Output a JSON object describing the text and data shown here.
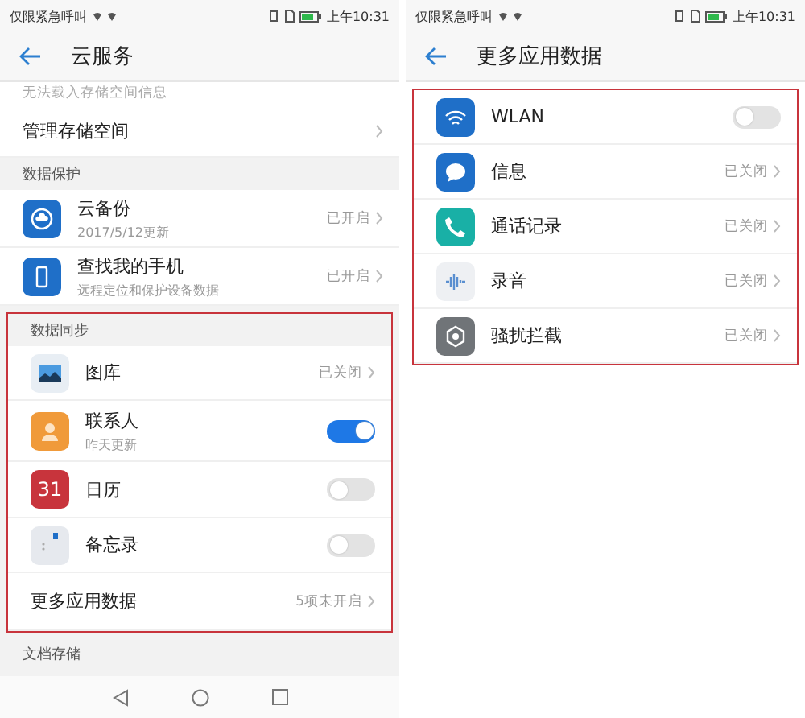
{
  "left_screen": {
    "status_bar": {
      "carrier": "仅限紧急呼叫",
      "time": "上午10:31"
    },
    "title": "云服务",
    "cut_note": "无法载入存储空间信息",
    "manage_row": {
      "label": "管理存储空间"
    },
    "sections": [
      {
        "title": "数据保护",
        "highlighted": false,
        "rows": [
          {
            "kind": "status",
            "label": "云备份",
            "sub": "2017/5/12更新",
            "value": "已开启"
          },
          {
            "kind": "status",
            "label": "查找我的手机",
            "sub": "远程定位和保护设备数据",
            "value": "已开启"
          }
        ]
      },
      {
        "title": "数据同步",
        "highlighted": true,
        "rows": [
          {
            "kind": "status",
            "label": "图库",
            "value": "已关闭"
          },
          {
            "kind": "toggle",
            "label": "联系人",
            "sub": "昨天更新",
            "on": true
          },
          {
            "kind": "toggle",
            "label": "日历",
            "icon_text": "31",
            "on": false
          },
          {
            "kind": "toggle",
            "label": "备忘录",
            "on": false
          },
          {
            "kind": "plain",
            "label": "更多应用数据",
            "value": "5项未开启"
          }
        ]
      },
      {
        "title": "文档存储",
        "highlighted": false
      }
    ]
  },
  "right_screen": {
    "status_bar": {
      "carrier": "仅限紧急呼叫",
      "time": "上午10:31"
    },
    "title": "更多应用数据",
    "highlighted": true,
    "rows": [
      {
        "kind": "toggle",
        "label": "WLAN",
        "on": false
      },
      {
        "kind": "status",
        "label": "信息",
        "value": "已关闭"
      },
      {
        "kind": "status",
        "label": "通话记录",
        "value": "已关闭"
      },
      {
        "kind": "status",
        "label": "录音",
        "value": "已关闭"
      },
      {
        "kind": "status",
        "label": "骚扰拦截",
        "value": "已关闭"
      }
    ]
  }
}
